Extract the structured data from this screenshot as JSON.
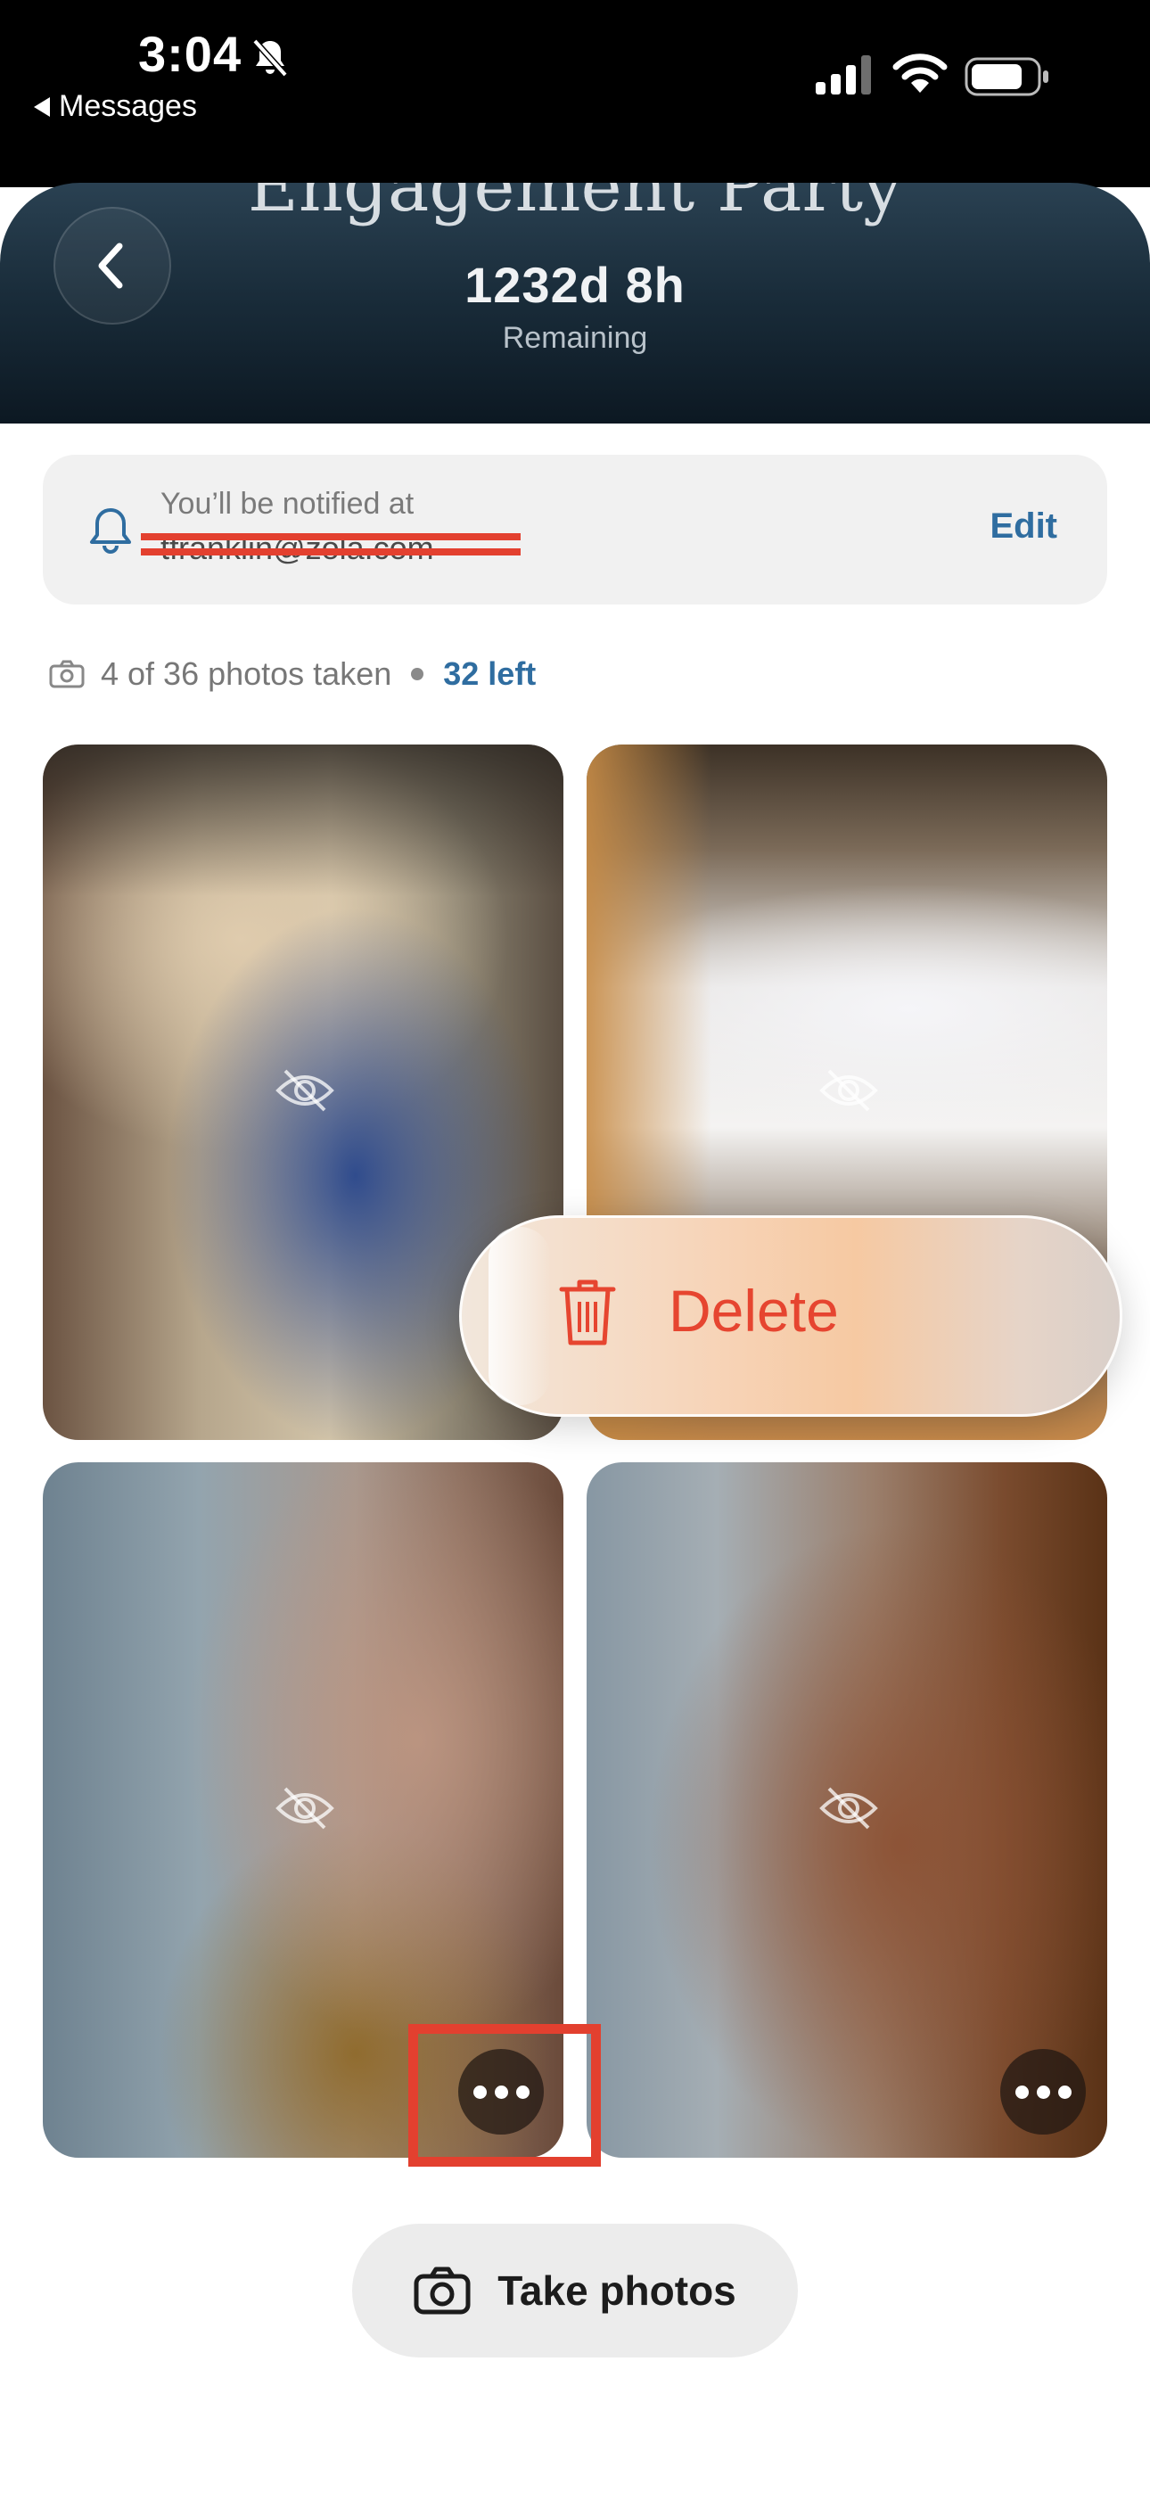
{
  "status_bar": {
    "time": "3:04",
    "back_app": "Messages"
  },
  "header": {
    "title": "Engagement Party",
    "countdown": "1232d 8h",
    "remaining_label": "Remaining"
  },
  "notification": {
    "label": "You’ll be notified at",
    "email": "tfranklin@zola.com",
    "edit_label": "Edit"
  },
  "photo_count": {
    "taken_text": "4 of 36 photos taken",
    "left_text": "32 left"
  },
  "context_menu": {
    "delete_label": "Delete"
  },
  "footer": {
    "take_photos_label": "Take photos"
  },
  "colors": {
    "accent_blue": "#2f6da0",
    "delete_red": "#e64530",
    "highlight_red": "#e3402f",
    "header_dark": "#0c1822"
  },
  "icons": [
    "bell-icon",
    "camera-icon",
    "eye-slash-icon",
    "more-icon",
    "trash-icon",
    "chevron-left-icon"
  ]
}
